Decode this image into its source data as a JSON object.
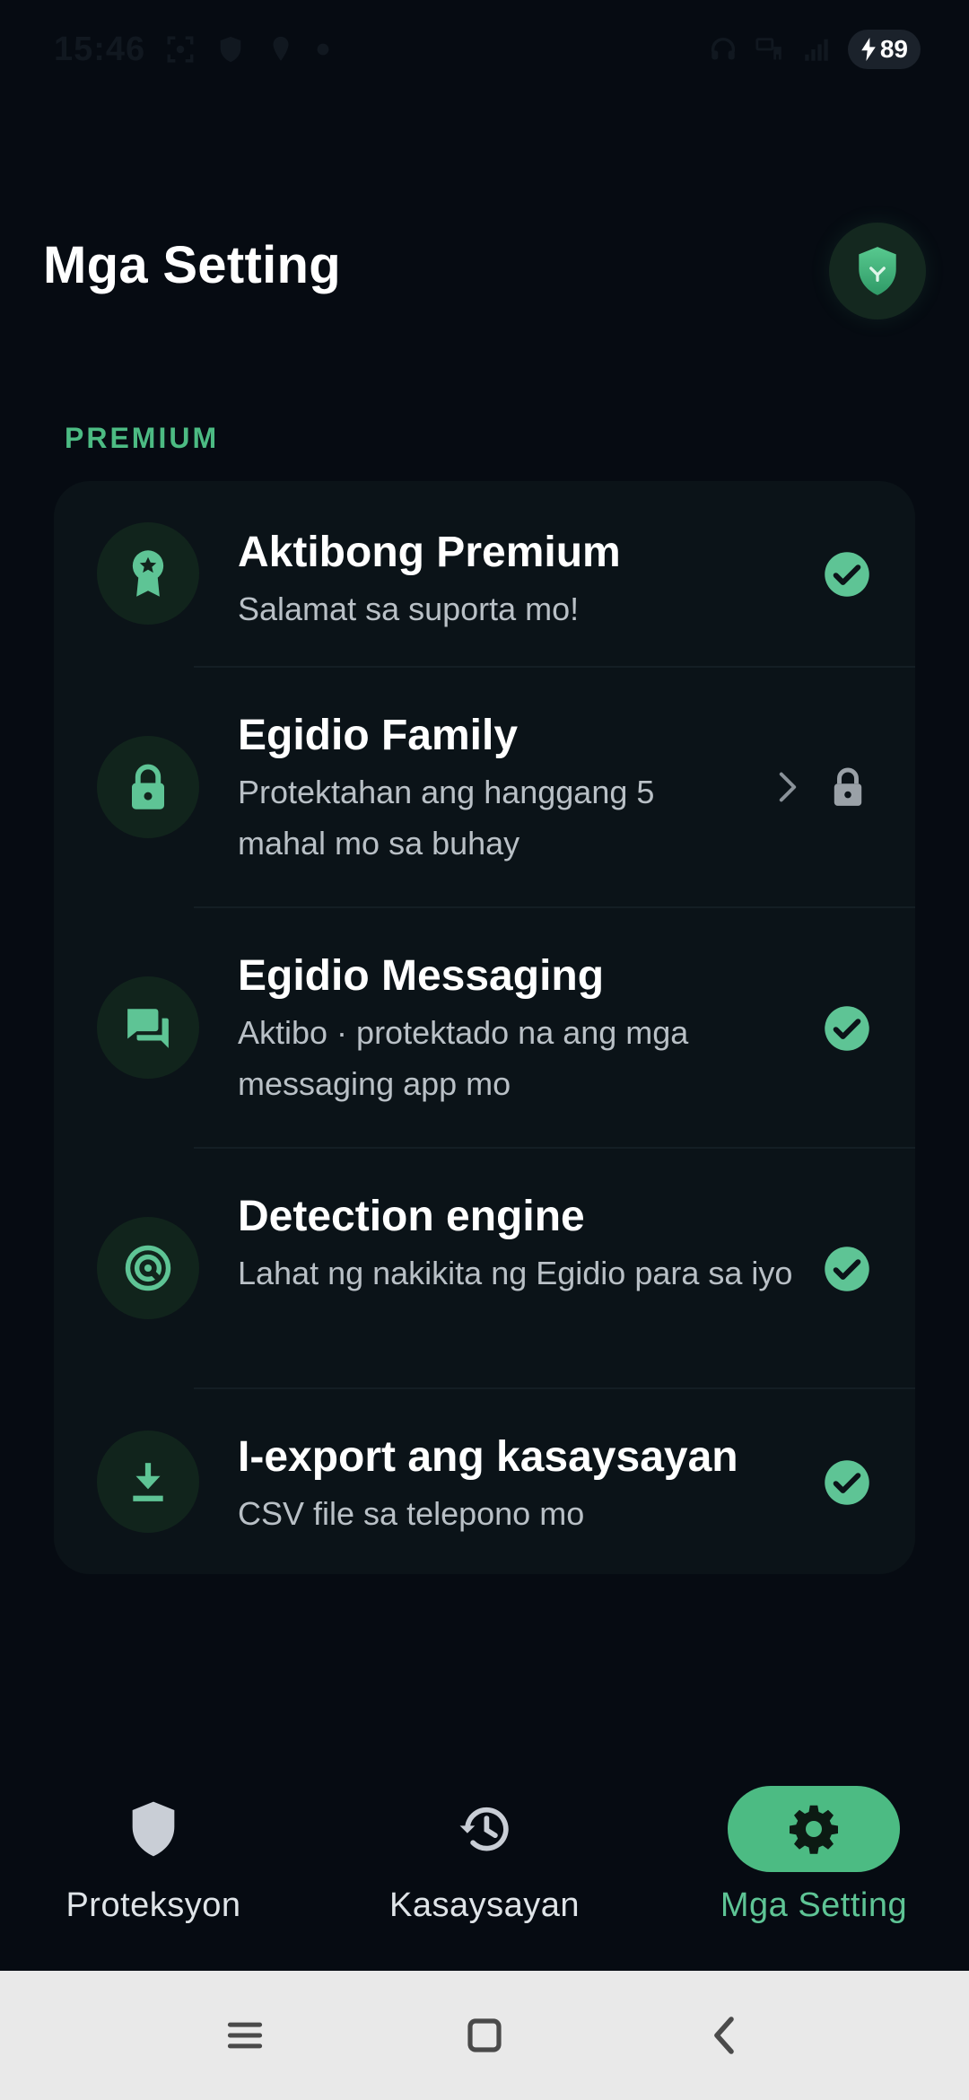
{
  "status_bar": {
    "time": "15:46",
    "battery": "89"
  },
  "header": {
    "title": "Mga Setting",
    "logo_icon": "shield-logo-icon"
  },
  "section": {
    "label": "PREMIUM"
  },
  "items": [
    {
      "title": "Aktibong Premium",
      "subtitle": "Salamat sa suporta mo!",
      "icon": "award-badge-icon",
      "status": "check-circle-icon"
    },
    {
      "title": "Egidio Family",
      "subtitle": "Protektahan ang hanggang 5 mahal mo sa buhay",
      "icon": "lock-icon",
      "status": "locked-chevron"
    },
    {
      "title": "Egidio Messaging",
      "subtitle": "Aktibo · protektado na ang mga messaging app mo",
      "icon": "chat-bubbles-icon",
      "status": "check-circle-icon"
    },
    {
      "title": "Detection engine",
      "subtitle": "Lahat ng nakikita ng Egidio para sa iyo",
      "icon": "target-icon",
      "status": "check-circle-icon"
    },
    {
      "title": "I-export ang kasaysayan",
      "subtitle": "CSV file sa telepono mo",
      "icon": "download-icon",
      "status": "check-circle-icon"
    }
  ],
  "bottom_nav": {
    "active": "Mga Setting",
    "items": [
      {
        "label": "Proteksyon",
        "icon": "shield-icon"
      },
      {
        "label": "Kasaysayan",
        "icon": "history-icon"
      },
      {
        "label": "Mga Setting",
        "icon": "gear-icon"
      }
    ]
  },
  "colors": {
    "background": "#060b12",
    "card": "#0b1318",
    "accent": "#4cbb83",
    "icon_circle": "#11241c",
    "subtitle": "#b9c0c6"
  }
}
